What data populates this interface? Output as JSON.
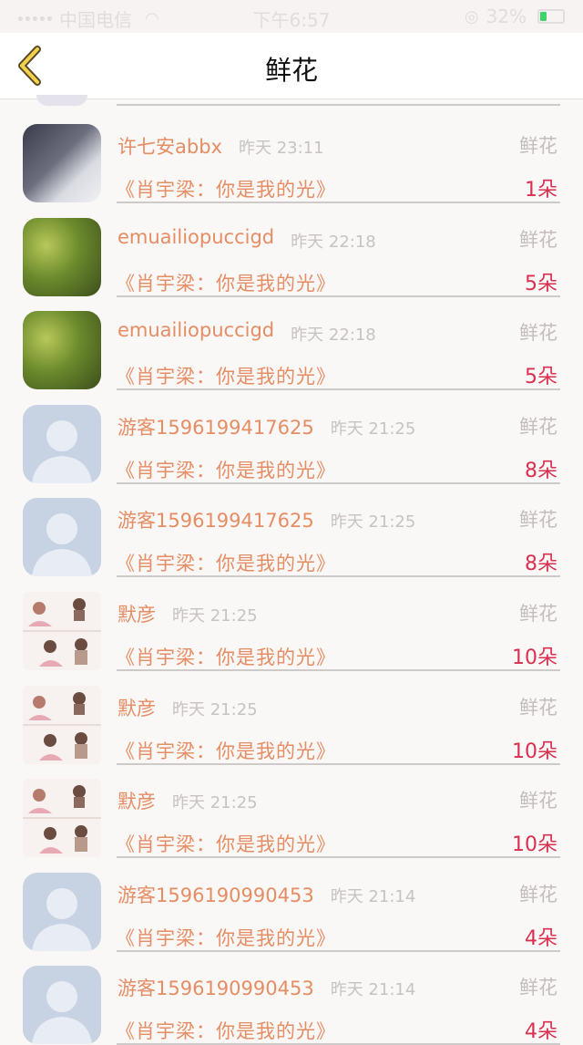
{
  "status_bar": {
    "carrier": "中国电信",
    "time": "下午6:57",
    "battery_percent": "32%",
    "battery_level": 0.32,
    "battery_color": "#3fd36b"
  },
  "nav": {
    "back_icon": "chevron-left-icon",
    "title": "鲜花"
  },
  "colors": {
    "name": "#e58d63",
    "count": "#d9304f",
    "muted": "#c4bdbd"
  },
  "rows": [
    {
      "name": "许七安abbx",
      "time": "昨天 23:11",
      "type": "鲜花",
      "song": "《肖宇梁：你是我的光》",
      "count": "1朵",
      "avatar": "photo-avatar"
    },
    {
      "name": "emuailiopuccigd",
      "time": "昨天 22:18",
      "type": "鲜花",
      "song": "《肖宇梁：你是我的光》",
      "count": "5朵",
      "avatar": "photo-avatar"
    },
    {
      "name": "emuailiopuccigd",
      "time": "昨天 22:18",
      "type": "鲜花",
      "song": "《肖宇梁：你是我的光》",
      "count": "5朵",
      "avatar": "photo-avatar"
    },
    {
      "name": "游客1596199417625",
      "time": "昨天 21:25",
      "type": "鲜花",
      "song": "《肖宇梁：你是我的光》",
      "count": "8朵",
      "avatar": "default-avatar"
    },
    {
      "name": "游客1596199417625",
      "time": "昨天 21:25",
      "type": "鲜花",
      "song": "《肖宇梁：你是我的光》",
      "count": "8朵",
      "avatar": "default-avatar"
    },
    {
      "name": "默彦",
      "time": "昨天 21:25",
      "type": "鲜花",
      "song": "《肖宇梁：你是我的光》",
      "count": "10朵",
      "avatar": "cartoon-avatar"
    },
    {
      "name": "默彦",
      "time": "昨天 21:25",
      "type": "鲜花",
      "song": "《肖宇梁：你是我的光》",
      "count": "10朵",
      "avatar": "cartoon-avatar"
    },
    {
      "name": "默彦",
      "time": "昨天 21:25",
      "type": "鲜花",
      "song": "《肖宇梁：你是我的光》",
      "count": "10朵",
      "avatar": "cartoon-avatar"
    },
    {
      "name": "游客1596190990453",
      "time": "昨天 21:14",
      "type": "鲜花",
      "song": "《肖宇梁：你是我的光》",
      "count": "4朵",
      "avatar": "default-avatar"
    },
    {
      "name": "游客1596190990453",
      "time": "昨天 21:14",
      "type": "鲜花",
      "song": "《肖宇梁：你是我的光》",
      "count": "4朵",
      "avatar": "default-avatar"
    }
  ]
}
